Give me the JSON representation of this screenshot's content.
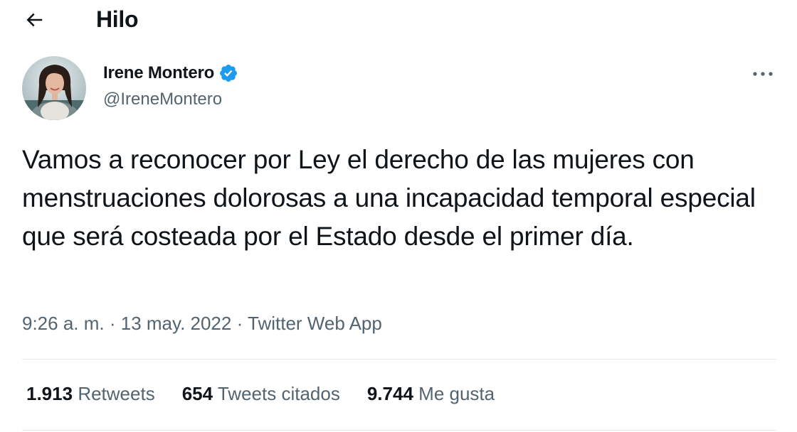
{
  "header": {
    "back_icon": "arrow-left-icon",
    "title": "Hilo"
  },
  "tweet": {
    "author": {
      "name": "Irene Montero",
      "handle": "@IreneMontero",
      "verified": true,
      "verified_color": "#1d9bf0"
    },
    "more_icon": "more-horizontal-icon",
    "text": "Vamos a reconocer por Ley el derecho de las mujeres con menstruaciones dolorosas a una incapacidad temporal especial que será costeada por el Estado desde el primer día.",
    "time": "9:26 a. m.",
    "separator": " · ",
    "date": "13 may. 2022",
    "source": "Twitter Web App",
    "stats": {
      "retweets_count": "1.913",
      "retweets_label": "Retweets",
      "quotes_count": "654",
      "quotes_label": "Tweets citados",
      "likes_count": "9.744",
      "likes_label": "Me gusta"
    }
  },
  "colors": {
    "text_primary": "#0f1419",
    "text_secondary": "#536471",
    "divider": "#e7e9ea",
    "accent": "#1d9bf0"
  }
}
